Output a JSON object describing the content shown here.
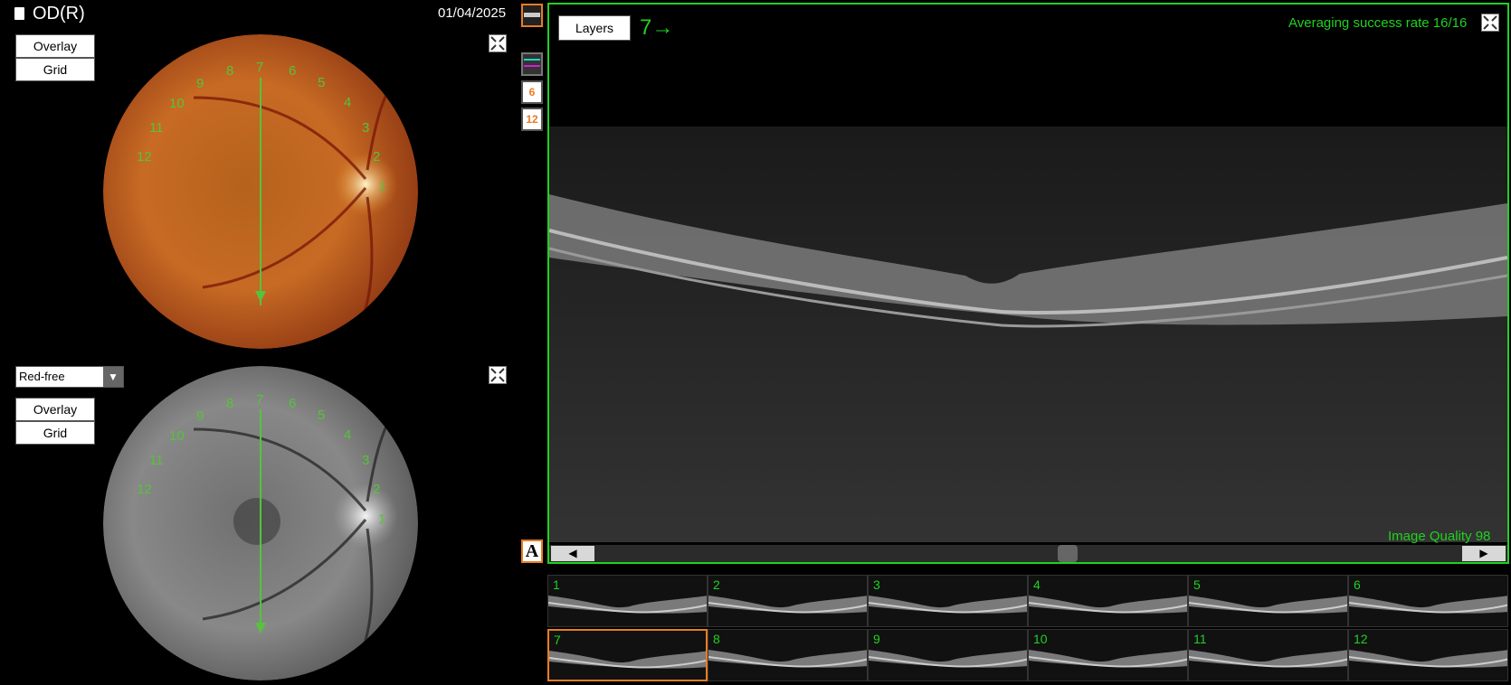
{
  "header": {
    "eye_label": "OD(R)",
    "date": "01/04/2025"
  },
  "top_panel": {
    "overlay_label": "Overlay",
    "grid_label": "Grid"
  },
  "bottom_panel": {
    "filter_value": "Red-free",
    "overlay_label": "Overlay",
    "grid_label": "Grid"
  },
  "grid_labels": [
    "1",
    "2",
    "3",
    "4",
    "5",
    "6",
    "7",
    "8",
    "9",
    "10",
    "11",
    "12"
  ],
  "oct": {
    "layers_label": "Layers",
    "scan_indicator": "7→",
    "averaging_text": "Averaging success rate 16/16",
    "quality_text": "Image Quality 98"
  },
  "thumbnails": [
    "1",
    "2",
    "3",
    "4",
    "5",
    "6",
    "7",
    "8",
    "9",
    "10",
    "11",
    "12"
  ],
  "tools": {
    "scan_a": "6",
    "scan_b": "12",
    "annotate": "A"
  },
  "colors": {
    "accent_green": "#1fd21f",
    "selection_orange": "#e87c24",
    "grid_green": "#55c43a"
  }
}
